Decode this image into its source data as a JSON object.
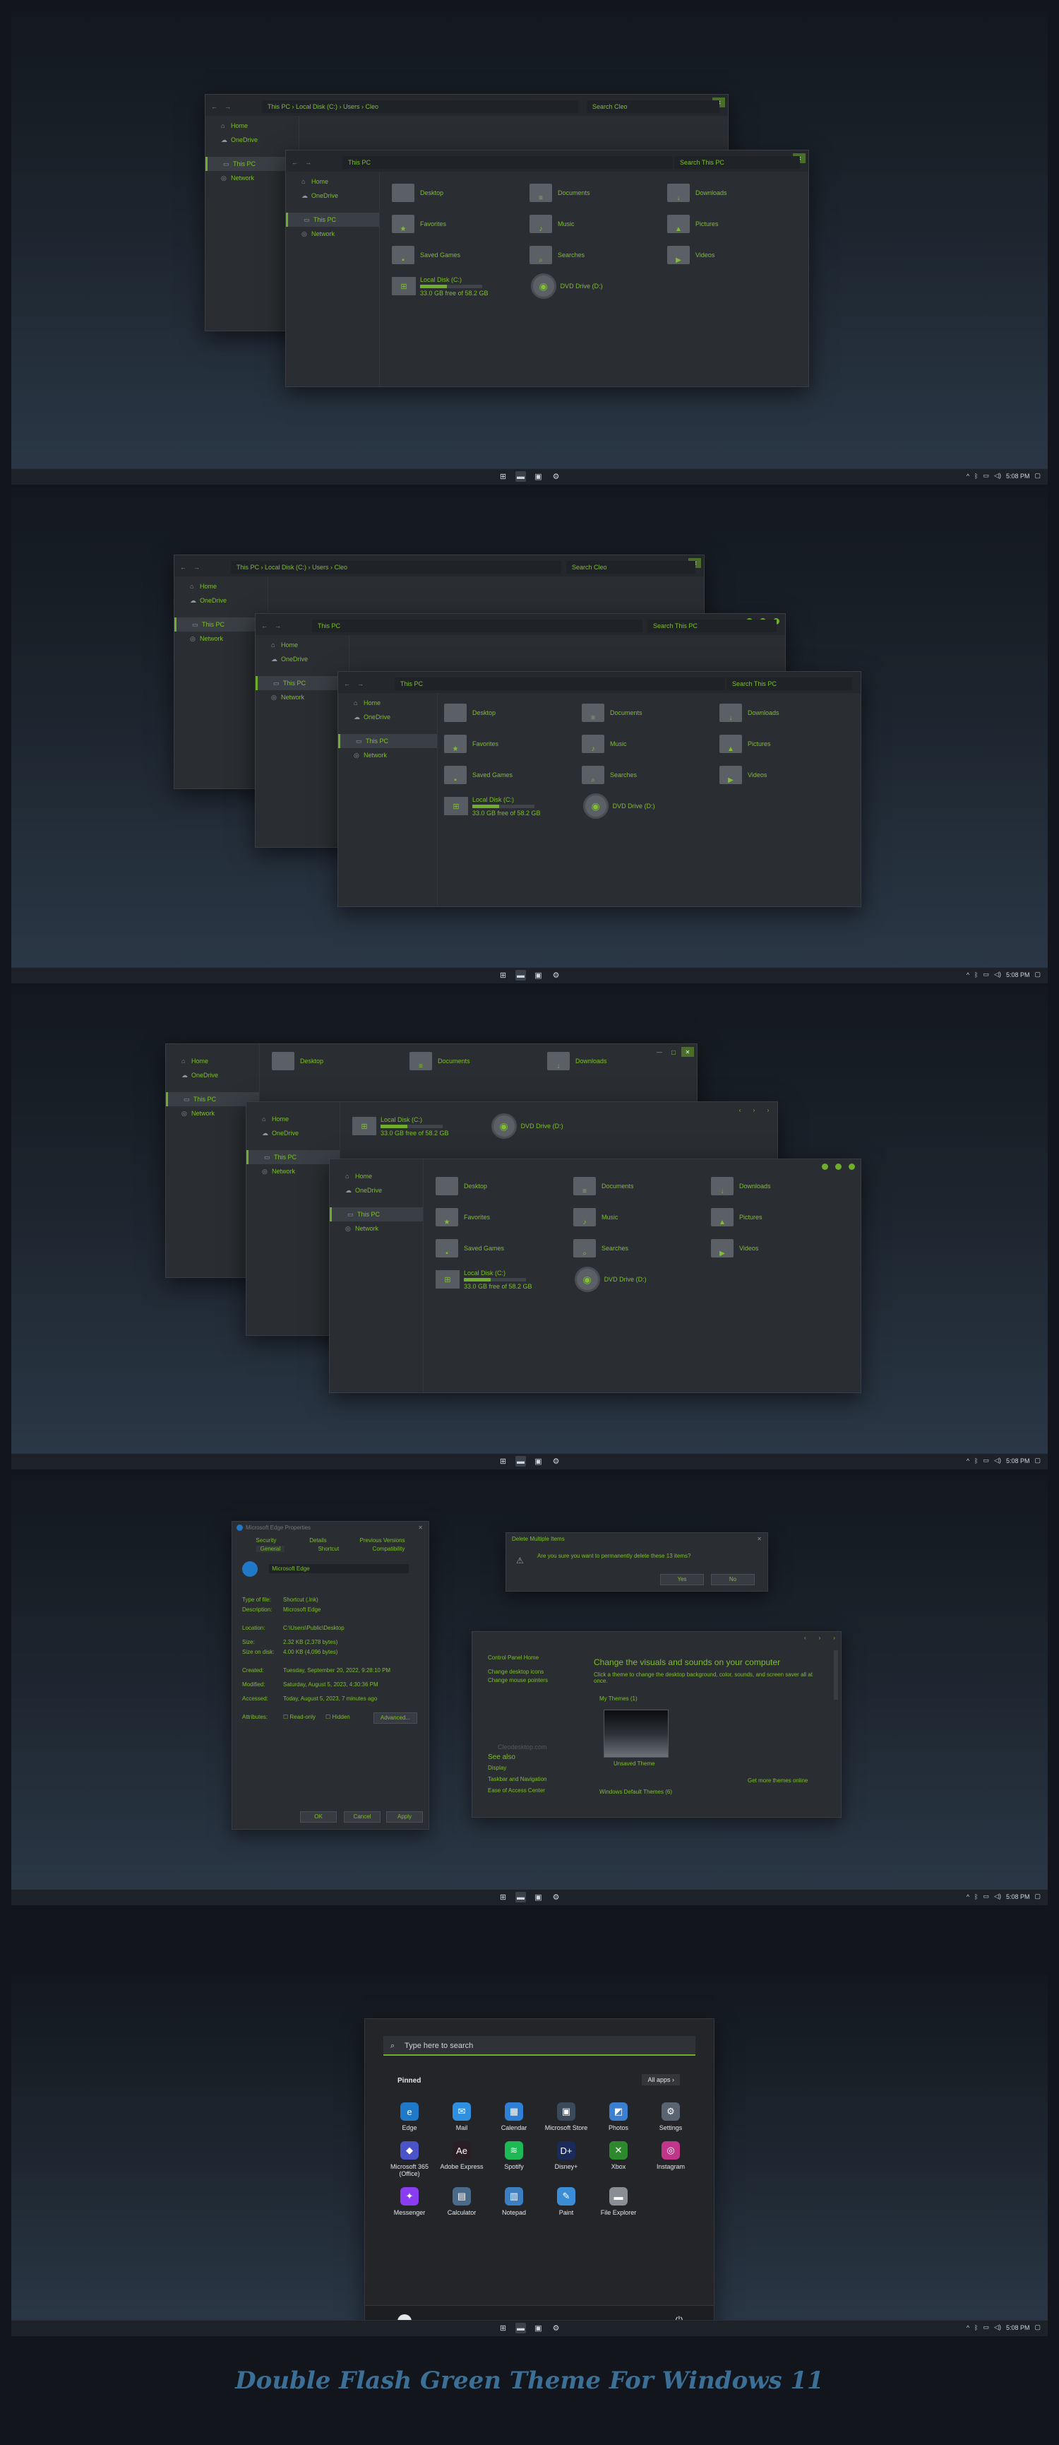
{
  "taskbar": {
    "time": "5:08 PM"
  },
  "explorer": {
    "path_segments": [
      "This PC",
      "Local Disk (C:)",
      "Users",
      "Cleo"
    ],
    "this_pc_path": "This PC",
    "search_cleo": "Search Cleo",
    "search_this_pc": "Search This PC",
    "nav_back": "←",
    "nav_forward": "→",
    "sidebar": [
      "Home",
      "OneDrive",
      "This PC",
      "Network"
    ],
    "folders": [
      "Desktop",
      "Documents",
      "Downloads",
      "Favorites",
      "Music",
      "Pictures",
      "Saved Games",
      "Searches",
      "Videos"
    ],
    "drive_c": {
      "name": "Local Disk (C:)",
      "free": "33.0 GB free of 58.2 GB",
      "used_fraction": 0.43
    },
    "drive_d": {
      "name": "DVD Drive (D:)"
    }
  },
  "properties": {
    "title": "Microsoft Edge Properties",
    "tabs_top": [
      "Security",
      "Details",
      "Previous Versions"
    ],
    "tabs_bottom": [
      "General",
      "Shortcut",
      "Compatibility"
    ],
    "name": "Microsoft Edge",
    "fields": [
      {
        "label": "Type of file:",
        "value": "Shortcut (.lnk)"
      },
      {
        "label": "Description:",
        "value": "Microsoft Edge"
      },
      {
        "label": "Location:",
        "value": "C:\\Users\\Public\\Desktop"
      },
      {
        "label": "Size:",
        "value": "2.32 KB (2,378 bytes)"
      },
      {
        "label": "Size on disk:",
        "value": "4.00 KB (4,096 bytes)"
      },
      {
        "label": "Created:",
        "value": "Tuesday, September 20, 2022, 9:28:10 PM"
      },
      {
        "label": "Modified:",
        "value": "Saturday, August 5, 2023, 4:30:36 PM"
      },
      {
        "label": "Accessed:",
        "value": "Today, August 5, 2023, 7 minutes ago"
      }
    ],
    "attributes": "Attributes:",
    "readonly": "Read-only",
    "hidden": "Hidden",
    "advanced": "Advanced...",
    "ok": "OK",
    "cancel": "Cancel",
    "apply": "Apply"
  },
  "delete_dialog": {
    "title": "Delete Multiple Items",
    "question": "Are you sure you want to permanently delete these 13 items?",
    "yes": "Yes",
    "no": "No"
  },
  "personalize": {
    "links": [
      "Control Panel Home",
      "Change desktop icons",
      "Change mouse pointers"
    ],
    "heading": "Change the visuals and sounds on your computer",
    "desc": "Click a theme to change the desktop background, color, sounds, and screen saver all at once.",
    "my_themes": "My Themes (1)",
    "unsaved": "Unsaved Theme",
    "watermark": "Cleodesktop.com",
    "see_also": "See also",
    "see_also_links": [
      "Display",
      "Taskbar and Navigation",
      "Ease of Access Center"
    ],
    "default_themes": "Windows Default Themes (6)",
    "more_online": "Get more themes online"
  },
  "start": {
    "search_placeholder": "Type here to search",
    "pinned": "Pinned",
    "all_apps": "All apps",
    "apps": [
      {
        "name": "Edge",
        "color": "#1f78c8",
        "glyph": "e"
      },
      {
        "name": "Mail",
        "color": "#2f8fe0",
        "glyph": "✉"
      },
      {
        "name": "Calendar",
        "color": "#2e7fd6",
        "glyph": "▦"
      },
      {
        "name": "Microsoft Store",
        "color": "#3b4a5a",
        "glyph": "▣"
      },
      {
        "name": "Photos",
        "color": "#3a7fd0",
        "glyph": "◩"
      },
      {
        "name": "Settings",
        "color": "#5a6470",
        "glyph": "⚙"
      },
      {
        "name": "Microsoft 365 (Office)",
        "color": "#4b53c9",
        "glyph": "◆"
      },
      {
        "name": "Adobe Express",
        "color": "#2a1e24",
        "glyph": "Ae"
      },
      {
        "name": "Spotify",
        "color": "#1db954",
        "glyph": "≋"
      },
      {
        "name": "Disney+",
        "color": "#1a2a5a",
        "glyph": "D+"
      },
      {
        "name": "Xbox",
        "color": "#2c8a2c",
        "glyph": "✕"
      },
      {
        "name": "Instagram",
        "color": "#c1358a",
        "glyph": "◎"
      },
      {
        "name": "Messenger",
        "color": "#8a3df0",
        "glyph": "✦"
      },
      {
        "name": "Calculator",
        "color": "#4a6a8a",
        "glyph": "▤"
      },
      {
        "name": "Notepad",
        "color": "#3c7ec2",
        "glyph": "▥"
      },
      {
        "name": "Paint",
        "color": "#3b8dd6",
        "glyph": "✎"
      },
      {
        "name": "File Explorer",
        "color": "#8a8f96",
        "glyph": "▬"
      }
    ]
  },
  "footer_title": "Double Flash Green Theme For Windows 11"
}
